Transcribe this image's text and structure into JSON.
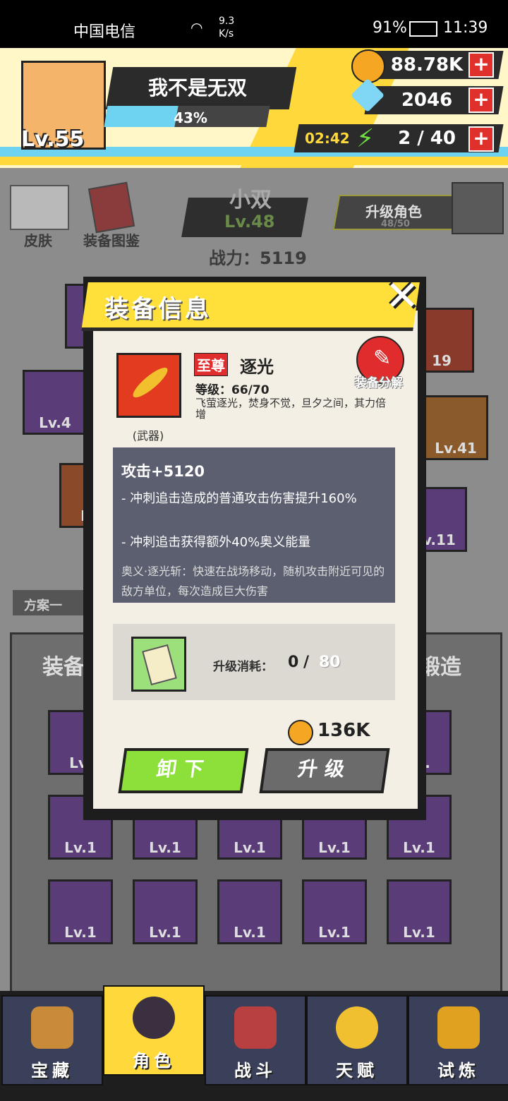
{
  "status_bar": {
    "carrier": "中国电信",
    "net_speed_value": "9.3",
    "net_speed_unit": "K/s",
    "battery": "91%",
    "time": "11:39"
  },
  "player": {
    "name": "我不是无双",
    "xp_percent": "43%",
    "level": "Lv.55"
  },
  "resources": {
    "gold": "88.78K",
    "diamonds": "2046",
    "energy_timer": "02:42",
    "energy": "2 / 40"
  },
  "character_screen": {
    "skin_label": "皮肤",
    "catalog_label": "装备图鉴",
    "character_name": "小双",
    "character_level": "Lv.48",
    "power": "战力：5119",
    "upgrade_character": "升级角色",
    "upgrade_progress": "48/50",
    "plan_label": "方案一",
    "equip_tab": "装备",
    "forge_tab": "锻造",
    "equipped_levels": [
      "Lv.4",
      "Lv.41",
      "Lv.11",
      "19"
    ],
    "inventory_levels": [
      "Lv.1",
      "Lv.1",
      "Lv.1",
      "Lv.1",
      "Lv.1",
      "Lv.1",
      "Lv.1",
      "Lv.1",
      "Lv.1",
      "Lv.1"
    ]
  },
  "modal": {
    "title": "装备信息",
    "close_icon": "close-x-icon",
    "item_rarity": "至尊",
    "item_name": "逐光",
    "item_level": "等级：66/70",
    "item_desc": "飞萤逐光，焚身不觉，旦夕之间，其力倍增",
    "item_type": "(武器)",
    "dismantle": "装备分解",
    "stat_attack": "攻击+5120",
    "effect_1": "- 冲刺追击造成的普通攻击伤害提升160%",
    "effect_2": "- 冲刺追击获得额外40%奥义能量",
    "skill_desc": "奥义·逐光斩：快速在战场移动，随机攻击附近可见的敌方单位，每次造成巨大伤害",
    "cost_label": "升级消耗：",
    "cost_have": "0",
    "cost_sep": "/",
    "cost_need": "80",
    "gold_cost": "136K",
    "unequip_button": "卸下",
    "upgrade_button": "升级"
  },
  "bottom_nav": [
    {
      "label": "宝藏",
      "icon": "treasure-chest-icon"
    },
    {
      "label": "角色",
      "icon": "character-icon"
    },
    {
      "label": "战斗",
      "icon": "battle-icon"
    },
    {
      "label": "天赋",
      "icon": "talent-bulb-icon"
    },
    {
      "label": "试炼",
      "icon": "trial-emblem-icon"
    }
  ],
  "colors": {
    "accent_yellow": "#ffd83b",
    "rarity_red": "#e02c2c",
    "unequip_green": "#8de03a",
    "upgrade_gray": "#6b6b6b",
    "stats_panel": "#5c5f70"
  }
}
